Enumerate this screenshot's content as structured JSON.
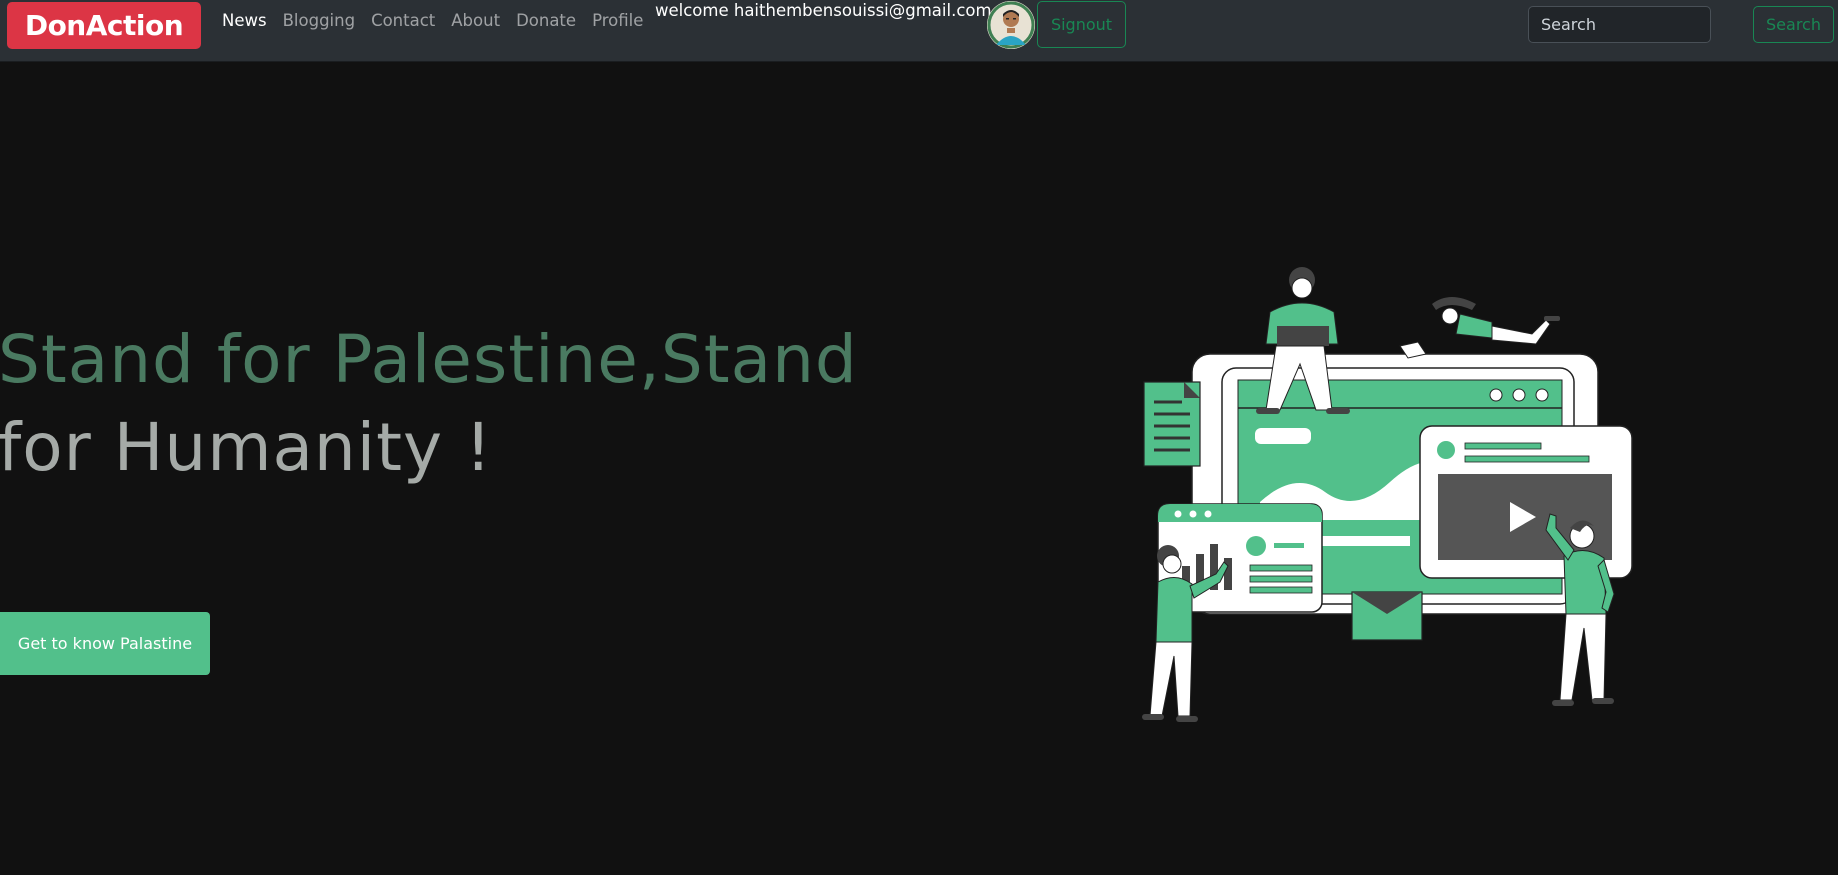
{
  "navbar": {
    "brand": "DonAction",
    "links": [
      {
        "label": "News"
      },
      {
        "label": "Blogging"
      },
      {
        "label": "Contact"
      },
      {
        "label": "About"
      },
      {
        "label": "Donate"
      },
      {
        "label": "Profile"
      }
    ],
    "welcome": "welcome haithembensouissi@gmail.com",
    "signout_label": "Signout",
    "search": {
      "placeholder": "Search",
      "button_label": "Search"
    }
  },
  "hero": {
    "title_line1": "Stand for Palestine,Stand",
    "title_line2": "for Humanity !",
    "cta_label": "Get to know Palastine"
  },
  "colors": {
    "accent_green": "#52c08b",
    "brand_red": "#dc3545",
    "outline_green": "#198754",
    "navbar_bg": "#2b3035",
    "page_bg": "#111111"
  }
}
